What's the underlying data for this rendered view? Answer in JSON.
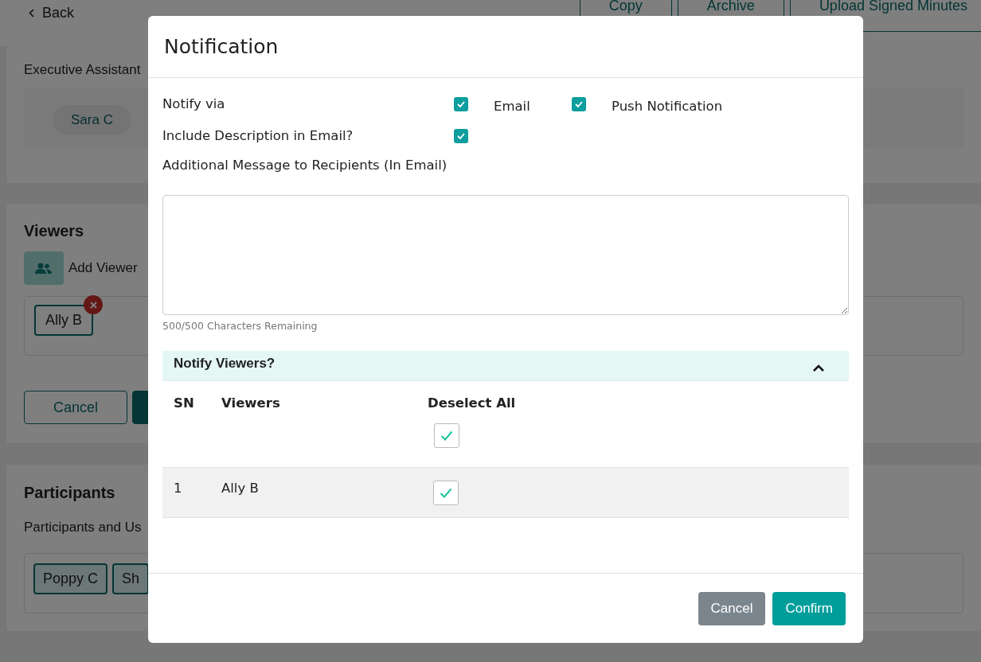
{
  "page": {
    "back": "Back",
    "actions": [
      "Copy",
      "Archive",
      "Upload Signed Minutes"
    ],
    "assistants": {
      "label": "Executive Assistant",
      "chips": [
        "Sara C"
      ]
    },
    "viewers": {
      "title": "Viewers",
      "add_label": "Add Viewer",
      "chips": [
        "Ally B"
      ],
      "cancel": "Cancel"
    },
    "participants": {
      "title": "Participants",
      "label": "Participants and Us",
      "chips": [
        "Poppy C",
        "Sh"
      ]
    }
  },
  "dialog": {
    "title": "Notification",
    "notify_via": {
      "label": "Notify via",
      "options": [
        {
          "label": "Email",
          "checked": true
        },
        {
          "label": "Push Notification",
          "checked": true
        }
      ]
    },
    "include_description": {
      "label": "Include Description in Email?",
      "checked": true
    },
    "message": {
      "label": "Additional Message to Recipients (In Email)",
      "counter": "500/500 Characters Remaining"
    },
    "viewers_section": {
      "title": "Notify Viewers?",
      "expanded": true,
      "columns": [
        "SN",
        "Viewers",
        "Deselect All"
      ],
      "select_all_checked": true,
      "rows": [
        {
          "sn": "1",
          "name": "Ally B",
          "checked": true
        }
      ]
    },
    "buttons": {
      "cancel": "Cancel",
      "confirm": "Confirm"
    }
  }
}
